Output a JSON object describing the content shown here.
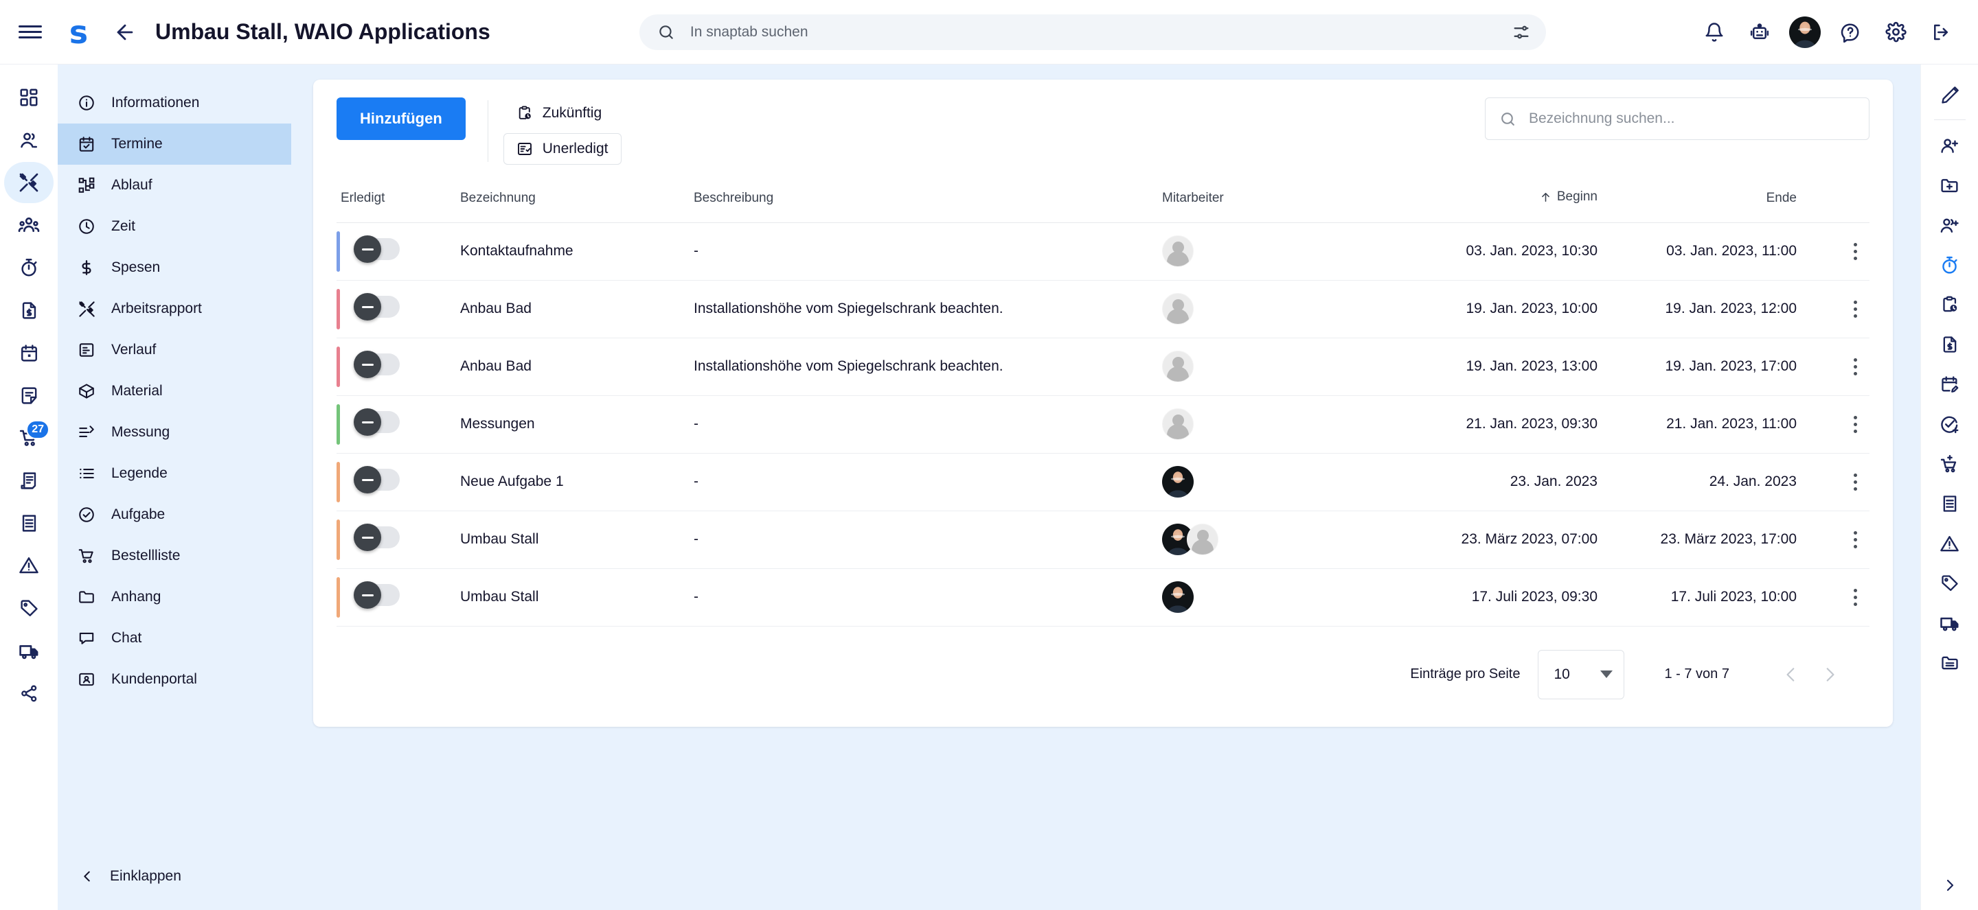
{
  "header": {
    "menu_icon": "hamburger-icon",
    "brand": "s",
    "back_icon": "arrow-left-icon",
    "title": "Umbau Stall, WAIO Applications",
    "search_placeholder": "In snaptab suchen",
    "search_icon": "search-icon",
    "filter_icon": "filter-sliders-icon",
    "right_icons": [
      {
        "name": "notifications-bell-icon",
        "glyph": "bell"
      },
      {
        "name": "bot-assistant-icon",
        "glyph": "robot"
      },
      {
        "name": "user-avatar",
        "glyph": "photo"
      },
      {
        "name": "help-icon",
        "glyph": "question"
      },
      {
        "name": "settings-gear-icon",
        "glyph": "gear"
      },
      {
        "name": "logout-icon",
        "glyph": "logout"
      }
    ]
  },
  "left_rail": {
    "items": [
      {
        "name": "dashboard-icon",
        "glyph": "dashboard"
      },
      {
        "name": "contacts-icon",
        "glyph": "person-pair"
      },
      {
        "name": "projects-tools-icon",
        "glyph": "tools",
        "active": true
      },
      {
        "name": "team-icon",
        "glyph": "people"
      },
      {
        "name": "timetracking-icon",
        "glyph": "stopwatch"
      },
      {
        "name": "invoice-icon",
        "glyph": "doc-dollar"
      },
      {
        "name": "calendar-icon",
        "glyph": "calendar"
      },
      {
        "name": "notes-icon",
        "glyph": "note"
      },
      {
        "name": "cart-icon",
        "glyph": "cart",
        "badge": "27"
      },
      {
        "name": "receipt-print-icon",
        "glyph": "receipt-print"
      },
      {
        "name": "receipt-icon",
        "glyph": "receipt"
      },
      {
        "name": "warning-icon",
        "glyph": "warning"
      },
      {
        "name": "tag-icon",
        "glyph": "tag"
      },
      {
        "name": "delivery-truck-icon",
        "glyph": "truck"
      },
      {
        "name": "share-icon",
        "glyph": "share"
      }
    ]
  },
  "sidebar": {
    "items": [
      {
        "label": "Informationen",
        "icon": "info-circle-icon",
        "glyph": "info"
      },
      {
        "label": "Termine",
        "icon": "calendar-check-icon",
        "glyph": "calendar-check",
        "active": true
      },
      {
        "label": "Ablauf",
        "icon": "workflow-icon",
        "glyph": "workflow"
      },
      {
        "label": "Zeit",
        "icon": "clock-icon",
        "glyph": "clock"
      },
      {
        "label": "Spesen",
        "icon": "dollar-icon",
        "glyph": "dollar"
      },
      {
        "label": "Arbeitsrapport",
        "icon": "tools-icon",
        "glyph": "tools"
      },
      {
        "label": "Verlauf",
        "icon": "history-doc-icon",
        "glyph": "historydoc"
      },
      {
        "label": "Material",
        "icon": "box-icon",
        "glyph": "box"
      },
      {
        "label": "Messung",
        "icon": "measure-icon",
        "glyph": "measure"
      },
      {
        "label": "Legende",
        "icon": "list-icon",
        "glyph": "list"
      },
      {
        "label": "Aufgabe",
        "icon": "task-check-icon",
        "glyph": "taskcheck"
      },
      {
        "label": "Bestellliste",
        "icon": "cart-icon",
        "glyph": "cart"
      },
      {
        "label": "Anhang",
        "icon": "folder-icon",
        "glyph": "folder"
      },
      {
        "label": "Chat",
        "icon": "chat-icon",
        "glyph": "chat"
      },
      {
        "label": "Kundenportal",
        "icon": "portal-user-icon",
        "glyph": "portal"
      }
    ],
    "collapse_label": "Einklappen",
    "collapse_icon": "chevron-left-icon"
  },
  "toolbar": {
    "add_label": "Hinzufügen",
    "chips": [
      {
        "label": "Zukünftig",
        "icon": "clipboard-clock-icon",
        "boxed": false
      },
      {
        "label": "Unerledigt",
        "icon": "list-check-icon",
        "boxed": true
      }
    ],
    "search_placeholder": "Bezeichnung suchen...",
    "search_icon": "search-icon"
  },
  "table": {
    "columns": [
      {
        "key": "erledigt",
        "label": "Erledigt"
      },
      {
        "key": "bezeichnung",
        "label": "Bezeichnung"
      },
      {
        "key": "beschreibung",
        "label": "Beschreibung"
      },
      {
        "key": "mitarbeiter",
        "label": "Mitarbeiter"
      },
      {
        "key": "beginn",
        "label": "Beginn",
        "sorted": true,
        "sort_icon": "arrow-up-icon"
      },
      {
        "key": "ende",
        "label": "Ende"
      }
    ],
    "rows": [
      {
        "accent": "#7c9fe8",
        "done": false,
        "bezeichnung": "Kontaktaufnahme",
        "beschreibung": "-",
        "mitarbeiter": [
          "placeholder"
        ],
        "beginn": "03. Jan. 2023, 10:30",
        "ende": "03. Jan. 2023, 11:00"
      },
      {
        "accent": "#e8808f",
        "done": false,
        "bezeichnung": "Anbau Bad",
        "beschreibung": "Installationshöhe vom Spiegelschrank beachten.",
        "mitarbeiter": [
          "placeholder"
        ],
        "beginn": "19. Jan. 2023, 10:00",
        "ende": "19. Jan. 2023, 12:00"
      },
      {
        "accent": "#e8808f",
        "done": false,
        "bezeichnung": "Anbau Bad",
        "beschreibung": "Installationshöhe vom Spiegelschrank beachten.",
        "mitarbeiter": [
          "placeholder"
        ],
        "beginn": "19. Jan. 2023, 13:00",
        "ende": "19. Jan. 2023, 17:00"
      },
      {
        "accent": "#74c47a",
        "done": false,
        "bezeichnung": "Messungen",
        "beschreibung": "-",
        "mitarbeiter": [
          "placeholder"
        ],
        "beginn": "21. Jan. 2023, 09:30",
        "ende": "21. Jan. 2023, 11:00"
      },
      {
        "accent": "#f0a878",
        "done": false,
        "bezeichnung": "Neue Aufgabe 1",
        "beschreibung": "-",
        "mitarbeiter": [
          "photo"
        ],
        "beginn": "23. Jan. 2023",
        "ende": "24. Jan. 2023"
      },
      {
        "accent": "#f0a878",
        "done": false,
        "bezeichnung": "Umbau Stall",
        "beschreibung": "-",
        "mitarbeiter": [
          "photo",
          "placeholder"
        ],
        "beginn": "23. März 2023, 07:00",
        "ende": "23. März 2023, 17:00"
      },
      {
        "accent": "#f0a878",
        "done": false,
        "bezeichnung": "Umbau Stall",
        "beschreibung": "-",
        "mitarbeiter": [
          "photo"
        ],
        "beginn": "17. Juli 2023, 09:30",
        "ende": "17. Juli 2023, 10:00"
      }
    ],
    "row_menu_icon": "kebab-menu-icon"
  },
  "pagination": {
    "per_page_label": "Einträge pro Seite",
    "per_page_value": "10",
    "range_label": "1 - 7 von 7",
    "prev_icon": "chevron-left-icon",
    "next_icon": "chevron-right-icon"
  },
  "right_rail": {
    "items": [
      {
        "name": "edit-pencil-icon",
        "glyph": "pencil"
      },
      {
        "name": "separator",
        "glyph": "sep"
      },
      {
        "name": "add-person-icon",
        "glyph": "person-add"
      },
      {
        "name": "add-folder-icon",
        "glyph": "folder-add"
      },
      {
        "name": "add-team-icon",
        "glyph": "people-add"
      },
      {
        "name": "start-timer-icon",
        "glyph": "stopwatch",
        "accent": "#1a7cf3"
      },
      {
        "name": "add-appointment-icon",
        "glyph": "clipboard-clock"
      },
      {
        "name": "add-invoice-icon",
        "glyph": "doc-dollar"
      },
      {
        "name": "edit-calendar-icon",
        "glyph": "calendar-edit"
      },
      {
        "name": "add-task-icon",
        "glyph": "check-add"
      },
      {
        "name": "add-cart-icon",
        "glyph": "cart-add"
      },
      {
        "name": "receipt-icon",
        "glyph": "receipt"
      },
      {
        "name": "warning-icon",
        "glyph": "warning"
      },
      {
        "name": "tag-icon",
        "glyph": "tag"
      },
      {
        "name": "delivery-truck-icon",
        "glyph": "truck"
      },
      {
        "name": "archive-folder-icon",
        "glyph": "folder-lines"
      }
    ],
    "expand_icon": "chevron-right-icon"
  },
  "colors": {
    "accent": "#1a7cf3",
    "nav_bg": "#e8f2fd",
    "nav_active": "#bcd9f6",
    "ink": "#1b2559"
  }
}
